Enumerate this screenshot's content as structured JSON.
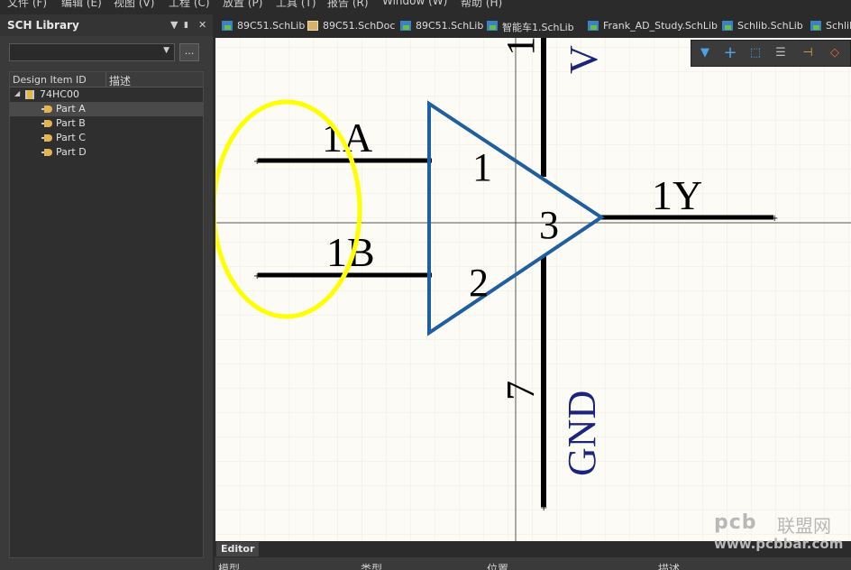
{
  "menu": [
    "文件 (F)",
    "编辑 (E)",
    "视图 (V)",
    "工程 (C)",
    "放置 (P)",
    "工具 (T)",
    "报告 (R)",
    "Window (W)",
    "帮助 (H)"
  ],
  "panel": {
    "title": "SCH Library",
    "controls": {
      "menu": "▼",
      "pin": "📌",
      "close": "✕"
    },
    "filter_value": "",
    "browse_label": "...",
    "columns": [
      "Design Item ID",
      "描述"
    ],
    "component": "74HC00",
    "parts": [
      "Part A",
      "Part B",
      "Part C",
      "Part D"
    ],
    "selected_part": "Part A"
  },
  "tabs": [
    {
      "label": "89C51.SchLib",
      "icon": "schlib-icon"
    },
    {
      "label": "89C51.SchDoc",
      "icon": "schdoc-icon"
    },
    {
      "label": "89C51.SchLib",
      "icon": "schlib-icon"
    },
    {
      "label": "智能车1.SchLib",
      "icon": "schlib-icon"
    },
    {
      "label": "Frank_AD_Study.SchLib",
      "icon": "schlib-icon"
    },
    {
      "label": "Schlib.SchLib",
      "icon": "schlib-icon"
    },
    {
      "label": "Schlib",
      "icon": "schlib-icon"
    }
  ],
  "canvas_toolbar": [
    "filter-icon",
    "add-icon",
    "select-rect-icon",
    "align-icon",
    "pin-icon",
    "erase-icon"
  ],
  "schematic": {
    "pins": {
      "in_a": "1A",
      "in_b": "1B",
      "out": "1Y"
    },
    "pin_numbers": {
      "a": "1",
      "b": "2",
      "out": "3",
      "vcc": "1",
      "gnd": "7"
    },
    "power": {
      "vcc": "V",
      "gnd": "GND"
    },
    "highlight_color": "#ffff00",
    "gate_color": "#1f5fa0",
    "label_color": "#1a237e"
  },
  "editor_tab": "Editor",
  "bottom_columns": [
    "模型",
    "类型",
    "位置",
    "描述"
  ],
  "watermark": {
    "brand": "pcb",
    "cn": "联盟网",
    "url": "www.pcbbar.com"
  }
}
